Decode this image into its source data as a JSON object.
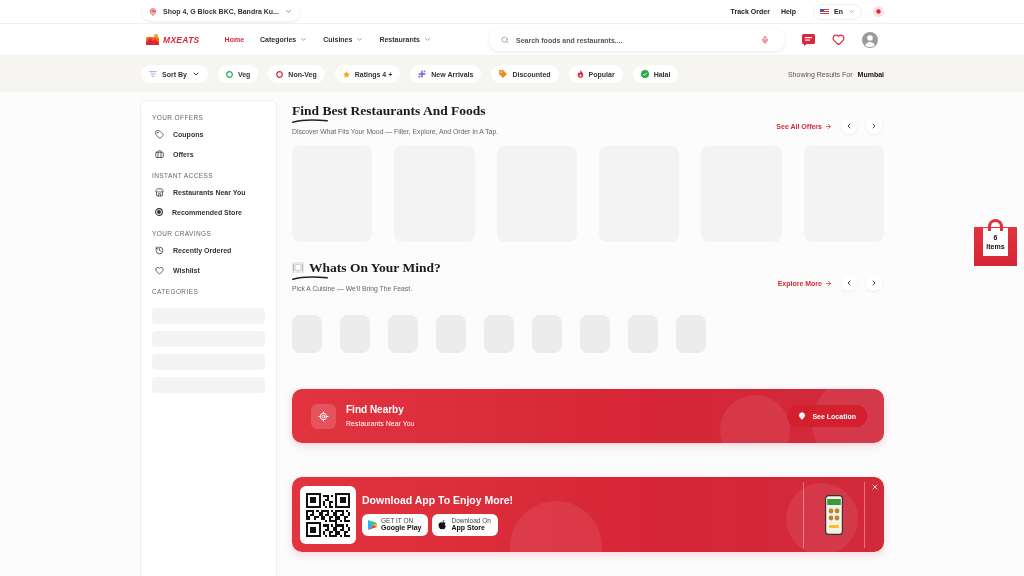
{
  "top_bar": {
    "location": "Shop 4, G Block BKC, Bandra Ku...",
    "links": [
      "Track Order",
      "Help"
    ],
    "language": "En"
  },
  "nav": {
    "logo": "MXEATS",
    "items": [
      {
        "label": "Home",
        "selected": true,
        "has_menu": false
      },
      {
        "label": "Categories",
        "selected": false,
        "has_menu": true
      },
      {
        "label": "Cuisines",
        "selected": false,
        "has_menu": true
      },
      {
        "label": "Restaurants",
        "selected": false,
        "has_menu": true
      }
    ],
    "search": {
      "placeholder": "Search foods and restaurants...."
    }
  },
  "filters": {
    "sort": "Sort By",
    "chips": [
      "Veg",
      "Non-Veg",
      "Ratings 4 +",
      "New Arrivals",
      "Discounted",
      "Popular",
      "Halal"
    ],
    "results_label": "Showing Results For",
    "results_city": "Mumbai"
  },
  "sidebar": {
    "sections": [
      {
        "title": "YOUR OFFERS",
        "items": [
          "Coupons",
          "Offers"
        ]
      },
      {
        "title": "INSTANT ACCESS",
        "items": [
          "Restaurants Near You",
          "Recommended Store"
        ]
      },
      {
        "title": "YOUR CRAVINGS",
        "items": [
          "Recently Ordered",
          "Wishlist"
        ]
      },
      {
        "title": "CATEGORIES"
      }
    ]
  },
  "sections": [
    {
      "kind": "cards",
      "title": "Find Best Restaurants And Foods",
      "subtitle": "Discover What Fits Your Mood — Filter, Explore, And Order In A Tap.",
      "link": "See All Offers"
    },
    {
      "kind": "cuisines",
      "title": "Whats On Your Mind?",
      "subtitle": "Pick A Cuisine — We'll Bring The Feast.",
      "link": "Explore More"
    }
  ],
  "nearby": {
    "title": "Find Nearby",
    "subtitle": "Restaurants Near You",
    "button": "See Location"
  },
  "app_banner": {
    "title": "Download App To Enjoy More!",
    "stores": [
      {
        "caption": "GET IT ON",
        "name": "Google Play"
      },
      {
        "caption": "Download On",
        "name": "App Store"
      }
    ]
  },
  "cart": {
    "count": "6",
    "label": "Items"
  }
}
